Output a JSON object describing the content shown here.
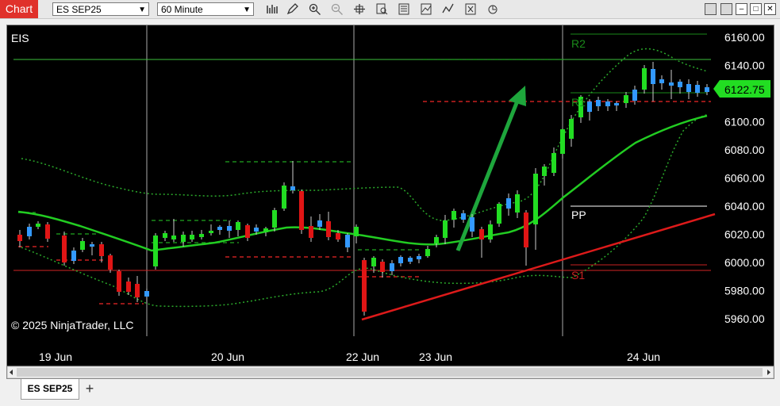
{
  "toolbar": {
    "chart_tab": "Chart",
    "instrument": "ES SEP25",
    "interval": "60 Minute",
    "icons": [
      "bars-type-icon",
      "draw-pencil-icon",
      "zoom-in-icon",
      "zoom-out-icon",
      "crosshair-icon",
      "data-box-icon",
      "properties-icon",
      "indicators-icon",
      "strategies-icon",
      "templates-icon",
      "share-icon"
    ]
  },
  "window": {
    "minimize": "–",
    "maximize": "□",
    "restore": "❐",
    "close": "✕"
  },
  "chart": {
    "symbol_label": "EIS",
    "copyright": "© 2025 NinjaTrader, LLC",
    "current_price": "6122.75",
    "price_ticks": [
      "6160.00",
      "6140.00",
      "6120.00",
      "6100.00",
      "6080.00",
      "6060.00",
      "6040.00",
      "6020.00",
      "6000.00",
      "5980.00",
      "5960.00"
    ],
    "date_labels": [
      "19 Jun",
      "20 Jun",
      "22 Jun",
      "23 Jun",
      "24 Jun"
    ],
    "pivot_labels": {
      "r2": "R2",
      "r1": "R1",
      "pp": "PP",
      "s1": "S1"
    },
    "colors": {
      "up": "#22dd22",
      "down": "#e01515",
      "doji": "#3399ff",
      "sma": "#22cc22",
      "pivot_green": "#1a8a1a",
      "pivot_red": "#c82020",
      "trend": "#dd1a1a"
    }
  },
  "tabs": {
    "active": "ES SEP25",
    "add": "+"
  }
}
